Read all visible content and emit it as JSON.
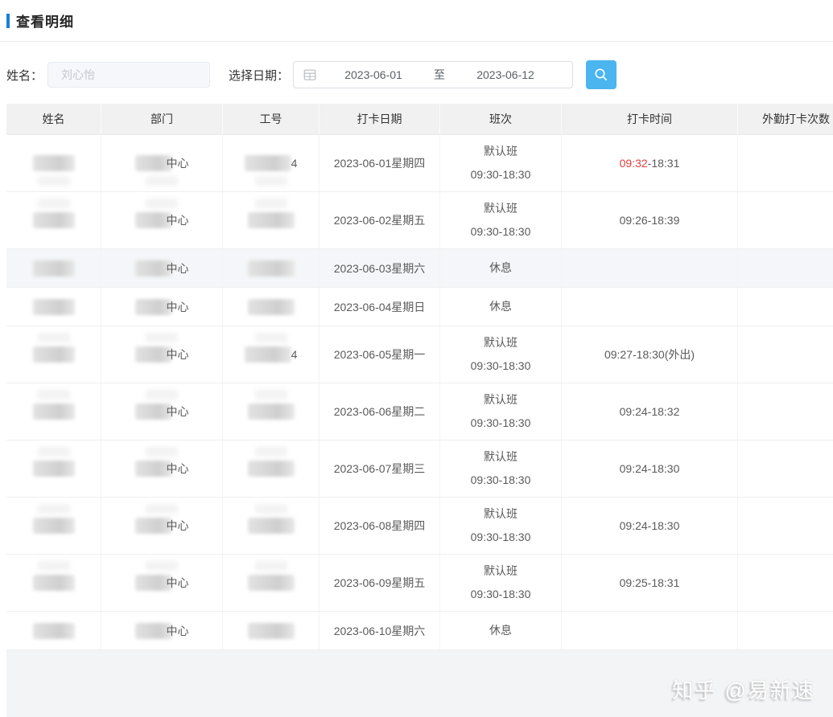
{
  "header": {
    "title": "查看明细"
  },
  "filters": {
    "name_label": "姓名：",
    "name_placeholder": "刘心怡",
    "date_label": "选择日期：",
    "date_start": "2023-06-01",
    "date_to": "至",
    "date_end": "2023-06-12"
  },
  "icons": {
    "calendar": "calendar-grid",
    "search": "magnifier"
  },
  "colors": {
    "accent": "#1a7fd4",
    "search_button": "#4ab5ee",
    "late_red": "#e23e3e",
    "header_bg": "#f1f1f2"
  },
  "table": {
    "columns": [
      "姓名",
      "部门",
      "工号",
      "打卡日期",
      "班次",
      "打卡时间",
      "外勤打卡次数"
    ],
    "rows": [
      {
        "dept_visible": "中心",
        "id_visible": "4",
        "date": "2023-06-01星期四",
        "shift": [
          "默认班",
          "09:30-18:30"
        ],
        "time_late": "09:32",
        "time": "-18:31",
        "field_count": "",
        "highlight": false
      },
      {
        "dept_visible": "中心",
        "id_visible": "",
        "date": "2023-06-02星期五",
        "shift": [
          "默认班",
          "09:30-18:30"
        ],
        "time_late": "",
        "time": "09:26-18:39",
        "field_count": "",
        "highlight": false
      },
      {
        "dept_visible": "中心",
        "id_visible": "",
        "date": "2023-06-03星期六",
        "shift": [
          "休息"
        ],
        "time_late": "",
        "time": "",
        "field_count": "",
        "highlight": true
      },
      {
        "dept_visible": "中心",
        "id_visible": "",
        "date": "2023-06-04星期日",
        "shift": [
          "休息"
        ],
        "time_late": "",
        "time": "",
        "field_count": "",
        "highlight": false
      },
      {
        "dept_visible": "中心",
        "id_visible": "4",
        "date": "2023-06-05星期一",
        "shift": [
          "默认班",
          "09:30-18:30"
        ],
        "time_late": "",
        "time": "09:27-18:30(外出)",
        "field_count": "",
        "highlight": false
      },
      {
        "dept_visible": "中心",
        "id_visible": "",
        "date": "2023-06-06星期二",
        "shift": [
          "默认班",
          "09:30-18:30"
        ],
        "time_late": "",
        "time": "09:24-18:32",
        "field_count": "",
        "highlight": false
      },
      {
        "dept_visible": "中心",
        "id_visible": "",
        "date": "2023-06-07星期三",
        "shift": [
          "默认班",
          "09:30-18:30"
        ],
        "time_late": "",
        "time": "09:24-18:30",
        "field_count": "",
        "highlight": false
      },
      {
        "dept_visible": "中心",
        "id_visible": "",
        "date": "2023-06-08星期四",
        "shift": [
          "默认班",
          "09:30-18:30"
        ],
        "time_late": "",
        "time": "09:24-18:30",
        "field_count": "",
        "highlight": false
      },
      {
        "dept_visible": "中心",
        "id_visible": "",
        "date": "2023-06-09星期五",
        "shift": [
          "默认班",
          "09:30-18:30"
        ],
        "time_late": "",
        "time": "09:25-18:31",
        "field_count": "",
        "highlight": false
      },
      {
        "dept_visible": "中心",
        "id_visible": "",
        "date": "2023-06-10星期六",
        "shift": [
          "休息"
        ],
        "time_late": "",
        "time": "",
        "field_count": "",
        "highlight": false
      }
    ]
  },
  "watermark": "知乎 @易新速"
}
